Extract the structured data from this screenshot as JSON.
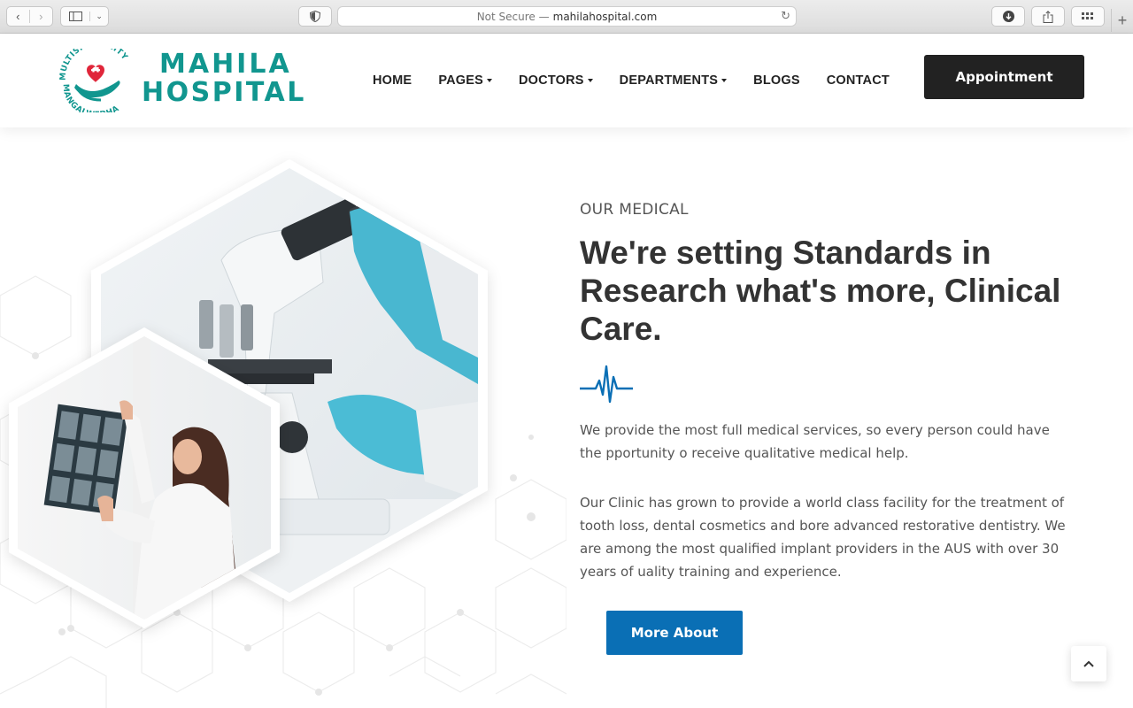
{
  "browser": {
    "security_label": "Not Secure —",
    "domain": "mahilahospital.com",
    "icons": [
      "back-icon",
      "forward-icon",
      "sidebar-icon",
      "chevron-down-icon",
      "shield-icon",
      "reload-icon",
      "download-icon",
      "share-icon",
      "tab-overview-icon",
      "plus-icon"
    ]
  },
  "header": {
    "logo": {
      "arc_top": "MULTISPECIALITY",
      "arc_bottom": "MANGALWEDHA",
      "line1": "MAHILA",
      "line2": "HOSPITAL",
      "color": "#11968f",
      "cross_color": "#e0263a"
    },
    "nav": [
      {
        "label": "HOME",
        "dropdown": false
      },
      {
        "label": "PAGES",
        "dropdown": true
      },
      {
        "label": "DOCTORS",
        "dropdown": true
      },
      {
        "label": "DEPARTMENTS",
        "dropdown": true
      },
      {
        "label": "BLOGS",
        "dropdown": false
      },
      {
        "label": "CONTACT",
        "dropdown": false
      }
    ],
    "appointment_label": "Appointment"
  },
  "main": {
    "eyebrow": "OUR MEDICAL",
    "headline": "We're setting Standards in Research what's more, Clinical Care.",
    "para1": "We provide the most full medical services, so every person could have the pportunity o receive qualitative medical help.",
    "para2": "Our Clinic has grown to provide a world class facility for the treatment of tooth loss, dental cosmetics and bore advanced restorative dentistry. We are among the most qualified implant providers in the AUS with over 30 years of uality training and experience.",
    "more_label": "More About",
    "accent_color": "#0a6fb5"
  },
  "scroll_top_icon": "chevron-up-icon"
}
